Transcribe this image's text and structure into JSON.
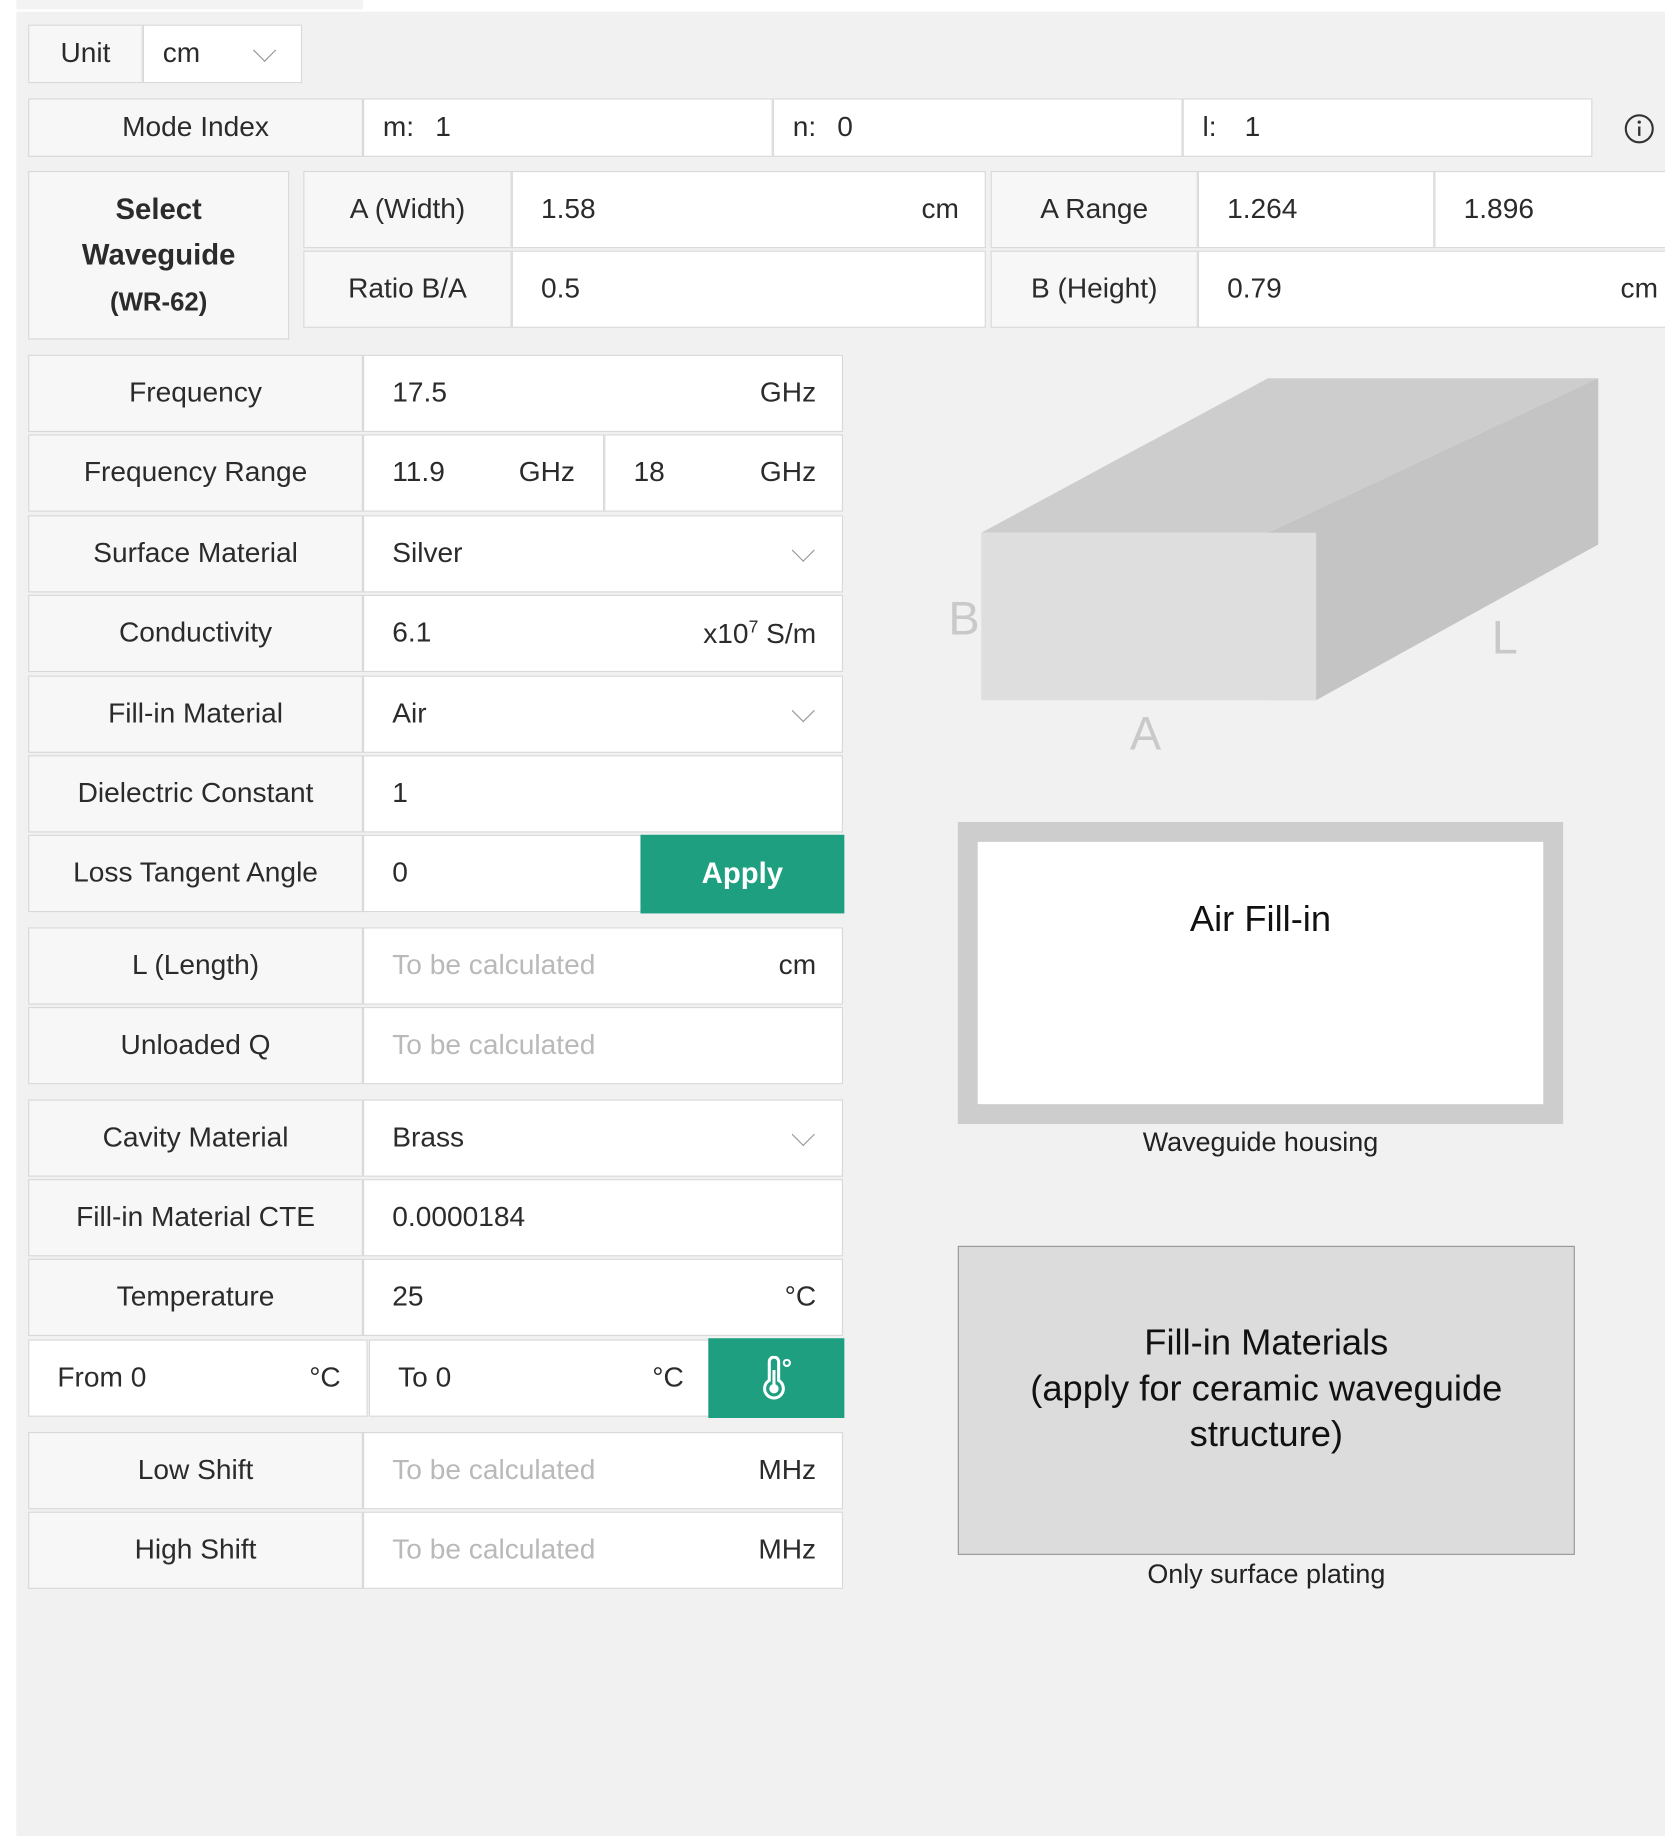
{
  "unit": {
    "label": "Unit",
    "value": "cm"
  },
  "mode_index": {
    "label": "Mode Index",
    "m_label": "m:",
    "m": "1",
    "n_label": "n:",
    "n": "0",
    "l_label": "l:",
    "l": "1"
  },
  "waveguide": {
    "select_line1": "Select",
    "select_line2": "Waveguide",
    "model": "(WR-62)",
    "a_width_label": "A (Width)",
    "a_width": "1.58",
    "a_width_unit": "cm",
    "a_range_label": "A Range",
    "a_range_min": "1.264",
    "a_range_max": "1.896",
    "ratio_label": "Ratio B/A",
    "ratio": "0.5",
    "b_height_label": "B (Height)",
    "b_height": "0.79",
    "b_height_unit": "cm"
  },
  "form": {
    "frequency_label": "Frequency",
    "frequency": "17.5",
    "frequency_unit": "GHz",
    "freq_range_label": "Frequency Range",
    "freq_min": "11.9",
    "freq_min_unit": "GHz",
    "freq_max": "18",
    "freq_max_unit": "GHz",
    "surface_material_label": "Surface Material",
    "surface_material": "Silver",
    "conductivity_label": "Conductivity",
    "conductivity": "6.1",
    "conductivity_unit_prefix": "x10",
    "conductivity_unit_exp": "7",
    "conductivity_unit_suffix": " S/m",
    "fillin_material_label": "Fill-in Material",
    "fillin_material": "Air",
    "dielectric_label": "Dielectric Constant",
    "dielectric": "1",
    "loss_tangent_label": "Loss Tangent Angle",
    "loss_tangent": "0",
    "apply_label": "Apply",
    "length_label": "L (Length)",
    "length_placeholder": "To be calculated",
    "length_unit": "cm",
    "unloaded_q_label": "Unloaded Q",
    "unloaded_q_placeholder": "To be calculated",
    "cavity_material_label": "Cavity Material",
    "cavity_material": "Brass",
    "cte_label": "Fill-in Material CTE",
    "cte": "0.0000184",
    "temperature_label": "Temperature",
    "temperature": "25",
    "temperature_unit": "°C",
    "from_label": "From 0",
    "from_unit": "°C",
    "to_label": "To 0",
    "to_unit": "°C",
    "low_shift_label": "Low Shift",
    "low_shift_placeholder": "To be calculated",
    "low_shift_unit": "MHz",
    "high_shift_label": "High Shift",
    "high_shift_placeholder": "To be calculated",
    "high_shift_unit": "MHz"
  },
  "figures": {
    "box_labels": {
      "b": "B",
      "a": "A",
      "l": "L"
    },
    "air_fillin_title": "Air Fill-in",
    "housing_caption": "Waveguide housing",
    "fillin_title_line1": "Fill-in Materials",
    "fillin_title_line2": "(apply for ceramic waveguide",
    "fillin_title_line3": "structure)",
    "plating_caption": "Only surface plating"
  },
  "icons": {
    "info": "info-icon",
    "thermometer": "thermometer-icon",
    "dropdown": "chevron-down-icon"
  },
  "colors": {
    "accent": "#1d9f80",
    "panel": "#f1f1f1",
    "placeholder": "#b9b9b9"
  }
}
